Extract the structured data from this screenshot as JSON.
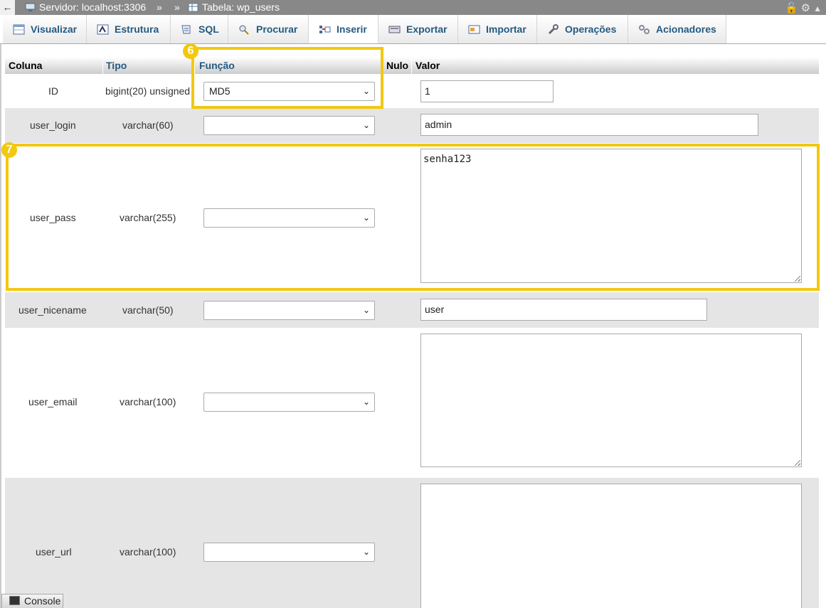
{
  "topbar": {
    "back_glyph": "←",
    "server_label": "Servidor: localhost:3306",
    "sep1": "»",
    "sep2": "»",
    "table_label": "Tabela: wp_users"
  },
  "tabs": [
    {
      "label": "Visualizar",
      "icon": "browse-icon"
    },
    {
      "label": "Estrutura",
      "icon": "structure-icon"
    },
    {
      "label": "SQL",
      "icon": "sql-icon"
    },
    {
      "label": "Procurar",
      "icon": "search-icon"
    },
    {
      "label": "Inserir",
      "icon": "insert-icon",
      "active": true
    },
    {
      "label": "Exportar",
      "icon": "export-icon"
    },
    {
      "label": "Importar",
      "icon": "import-icon"
    },
    {
      "label": "Operações",
      "icon": "operations-icon"
    },
    {
      "label": "Acionadores",
      "icon": "triggers-icon"
    }
  ],
  "table_header": {
    "col_column": "Coluna",
    "col_type": "Tipo",
    "col_function": "Função",
    "col_null": "Nulo",
    "col_value": "Valor"
  },
  "rows": [
    {
      "column": "ID",
      "type": "bigint(20) unsigned",
      "function": "MD5",
      "value": "1"
    },
    {
      "column": "user_login",
      "type": "varchar(60)",
      "function": "",
      "value": "admin"
    },
    {
      "column": "user_pass",
      "type": "varchar(255)",
      "function": "",
      "value": "senha123"
    },
    {
      "column": "user_nicename",
      "type": "varchar(50)",
      "function": "",
      "value": "user"
    },
    {
      "column": "user_email",
      "type": "varchar(100)",
      "function": "",
      "value": ""
    },
    {
      "column": "user_url",
      "type": "varchar(100)",
      "function": "",
      "value": ""
    }
  ],
  "annotations": {
    "badge_6": "6",
    "badge_7": "7"
  },
  "console": {
    "label": "Console"
  },
  "colors": {
    "highlight": "#f2c811",
    "link": "#235a81",
    "row_alt": "#e5e5e5"
  }
}
